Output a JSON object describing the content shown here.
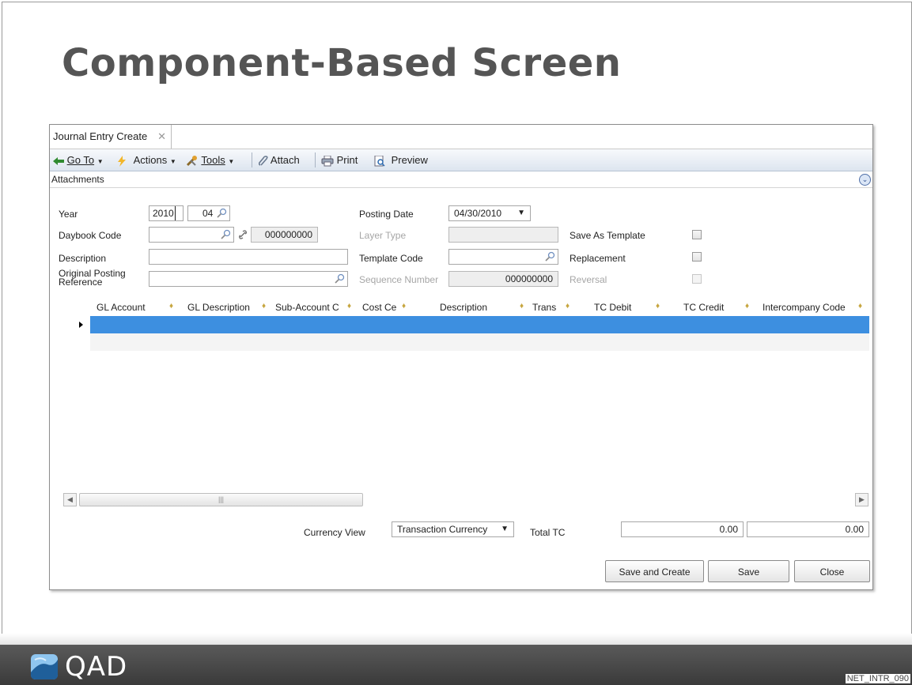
{
  "slide": {
    "title": "Component-Based Screen",
    "code": "NET_INTR_090",
    "logo_text": "QAD"
  },
  "app": {
    "tab_label": "Journal Entry Create",
    "tab_close": "✕",
    "toolbar": {
      "goto_label": "Go To",
      "actions_label": "Actions",
      "tools_label": "Tools",
      "attach_label": "Attach",
      "print_label": "Print",
      "preview_label": "Preview"
    },
    "attachments_label": "Attachments",
    "form": {
      "year_label": "Year",
      "year_value": "2010",
      "period_value": "04",
      "daybook_label": "Daybook Code",
      "daybook_number": "000000000",
      "description_label": "Description",
      "orig_posting_label_1": "Original Posting",
      "orig_posting_label_2": "Reference",
      "posting_date_label": "Posting Date",
      "posting_date_value": "04/30/2010",
      "layer_type_label": "Layer Type",
      "template_code_label": "Template Code",
      "sequence_label": "Sequence Number",
      "sequence_value": "000000000",
      "save_template_label": "Save As Template",
      "replacement_label": "Replacement",
      "reversal_label": "Reversal"
    },
    "grid": {
      "columns": [
        "GL Account",
        "GL Description",
        "Sub-Account C",
        "Cost Ce",
        "Description",
        "Trans",
        "TC Debit",
        "TC Credit",
        "Intercompany Code"
      ]
    },
    "bottom": {
      "currency_view_label": "Currency View",
      "currency_view_value": "Transaction Currency",
      "total_tc_label": "Total TC",
      "total_debit": "0.00",
      "total_credit": "0.00"
    },
    "buttons": {
      "save_and_create": "Save and Create",
      "save": "Save",
      "close": "Close"
    }
  },
  "colors": {
    "selected_row": "#3d8fe0",
    "title_text": "#555555"
  }
}
